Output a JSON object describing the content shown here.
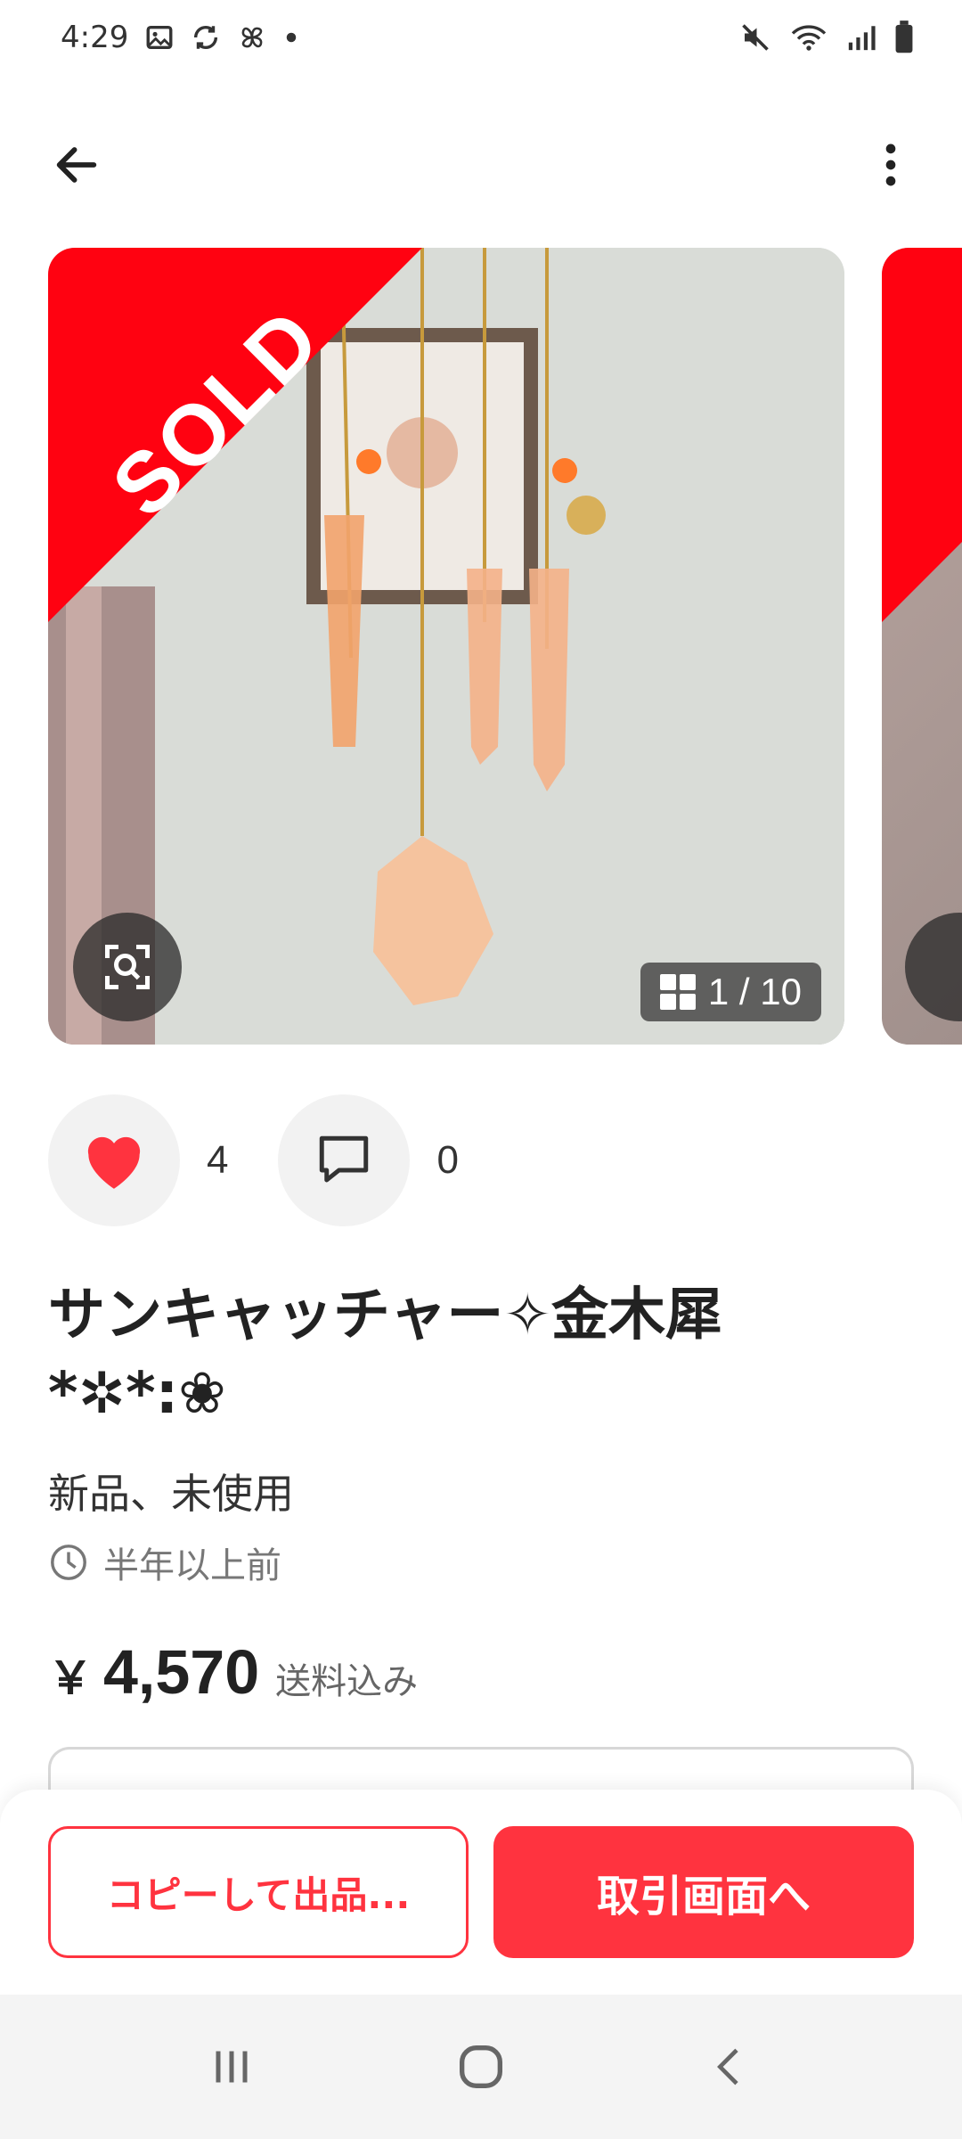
{
  "status_bar": {
    "time": "4:29",
    "left_icons": [
      "image-icon",
      "sync-icon",
      "pinwheel-icon",
      "dot-icon"
    ],
    "right_icons": [
      "mute-icon",
      "wifi-icon",
      "signal-icon",
      "battery-icon"
    ]
  },
  "app_bar": {
    "back_icon": "arrow-left-icon",
    "menu_icon": "more-vertical-icon"
  },
  "gallery": {
    "sold_label": "SOLD",
    "counter": "1 / 10",
    "zoom_icon": "image-search-icon"
  },
  "reactions": {
    "likes": "4",
    "comments": "0"
  },
  "item": {
    "title": "サンキャッチャー✧金木犀*✲*:❀",
    "condition": "新品、未使用",
    "posted": "半年以上前",
    "price_symbol": "￥",
    "price": "4,570",
    "shipping_note": "送料込み"
  },
  "actions": {
    "copy_label": "コピーして出品...",
    "trade_label": "取引画面へ"
  },
  "colors": {
    "accent": "#ff333f",
    "sold_red": "#ff0211",
    "heart": "#ff333f"
  },
  "nav": [
    "recents-icon",
    "home-icon",
    "back-icon"
  ]
}
